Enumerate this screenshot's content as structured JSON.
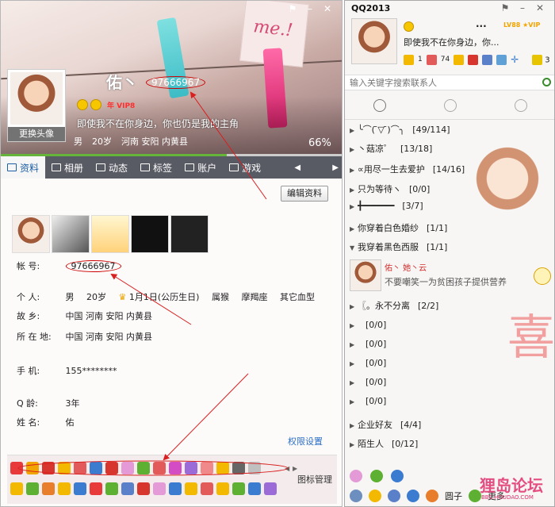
{
  "profile": {
    "nickname": "佑丶",
    "qq_number": "97666967",
    "change_avatar": "更换头像",
    "vip": "年 VIP8",
    "signature": "即使我不在你身边，你也仍是我的主角",
    "basic": [
      "男",
      "20岁",
      "河南 安阳 内黄县"
    ],
    "progress": "66%",
    "progress_value": 0.66,
    "colors": {
      "tab_bar": "#585a64",
      "active_tab_text": "#1d5fa6",
      "accent_red": "#cc0000",
      "link": "#2a6fc9",
      "progress_green": "#64b539"
    },
    "tabs": [
      {
        "label": "资料",
        "icon": "profile-icon"
      },
      {
        "label": "相册",
        "icon": "album-icon"
      },
      {
        "label": "动态",
        "icon": "feed-icon"
      },
      {
        "label": "标签",
        "icon": "tag-icon"
      },
      {
        "label": "账户",
        "icon": "wallet-icon"
      },
      {
        "label": "游戏",
        "icon": "game-icon"
      }
    ],
    "edit_button": "编辑资料",
    "info": {
      "account_label": "帐    号:",
      "account_value": "97666967",
      "personal_label": "个    人:",
      "gender": "男",
      "age": "20岁",
      "birthday": "1月1日(公历生日)",
      "zodiac": "属猴",
      "constellation": "摩羯座",
      "blood": "其它血型",
      "hometown_label": "故    乡:",
      "hometown": "中国 河南 安阳 内黄县",
      "location_label": "所 在 地:",
      "location": "中国 河南 安阳 内黄县",
      "phone_label": "手    机:",
      "phone": "155********",
      "qage_label": "Q    龄:",
      "qage": "3年",
      "name_label": "姓    名:",
      "name": "佑"
    },
    "permission_link": "权限设置",
    "badge_manage": "图标管理"
  },
  "qq": {
    "title": "QQ2013",
    "status_dots": "...",
    "level": "LV88 ★VIP",
    "signature": "即使我不在你身边，你...",
    "quick": {
      "mail_count": "1",
      "inbox_count": "74",
      "right_count": "3"
    },
    "search_placeholder": "输入关键字搜索联系人",
    "groups": [
      {
        "name": "╰⌒( ̄▽ ̄)⌒╮",
        "count": "[49/114]",
        "expanded": false
      },
      {
        "name": "丶菇凉゜",
        "count": "[13/18]",
        "expanded": false
      },
      {
        "name": "∝用尽一生去爱护",
        "count": "[14/16]",
        "expanded": false
      },
      {
        "name": "只为等待ヽ",
        "count": "[0/0]",
        "expanded": false
      },
      {
        "name": "╋━━━━━━",
        "count": "[3/7]",
        "expanded": false
      },
      {
        "name": "你穿着白色婚纱",
        "count": "[1/1]",
        "expanded": false
      },
      {
        "name": "我穿着黑色西服",
        "count": "[1/1]",
        "expanded": true
      },
      {
        "name": "〖。永不分离",
        "count": "[2/2]",
        "expanded": false
      },
      {
        "name": "",
        "count": "[0/0]",
        "expanded": false
      },
      {
        "name": "",
        "count": "[0/0]",
        "expanded": false
      },
      {
        "name": "",
        "count": "[0/0]",
        "expanded": false
      },
      {
        "name": "",
        "count": "[0/0]",
        "expanded": false
      },
      {
        "name": "",
        "count": "[0/0]",
        "expanded": false
      },
      {
        "name": "企业好友",
        "count": "[4/4]",
        "expanded": false
      },
      {
        "name": "陌生人",
        "count": "[0/12]",
        "expanded": false
      }
    ],
    "contact": {
      "name": "佑丶 她丶云",
      "signature": "不要嘲笑一为贫困孩子提供营养"
    },
    "bottom": {
      "circle": "圆子",
      "more": "更多"
    },
    "watermark": "狸岛论坛",
    "watermark_sub": "BBS.HOUDAO.COM"
  }
}
